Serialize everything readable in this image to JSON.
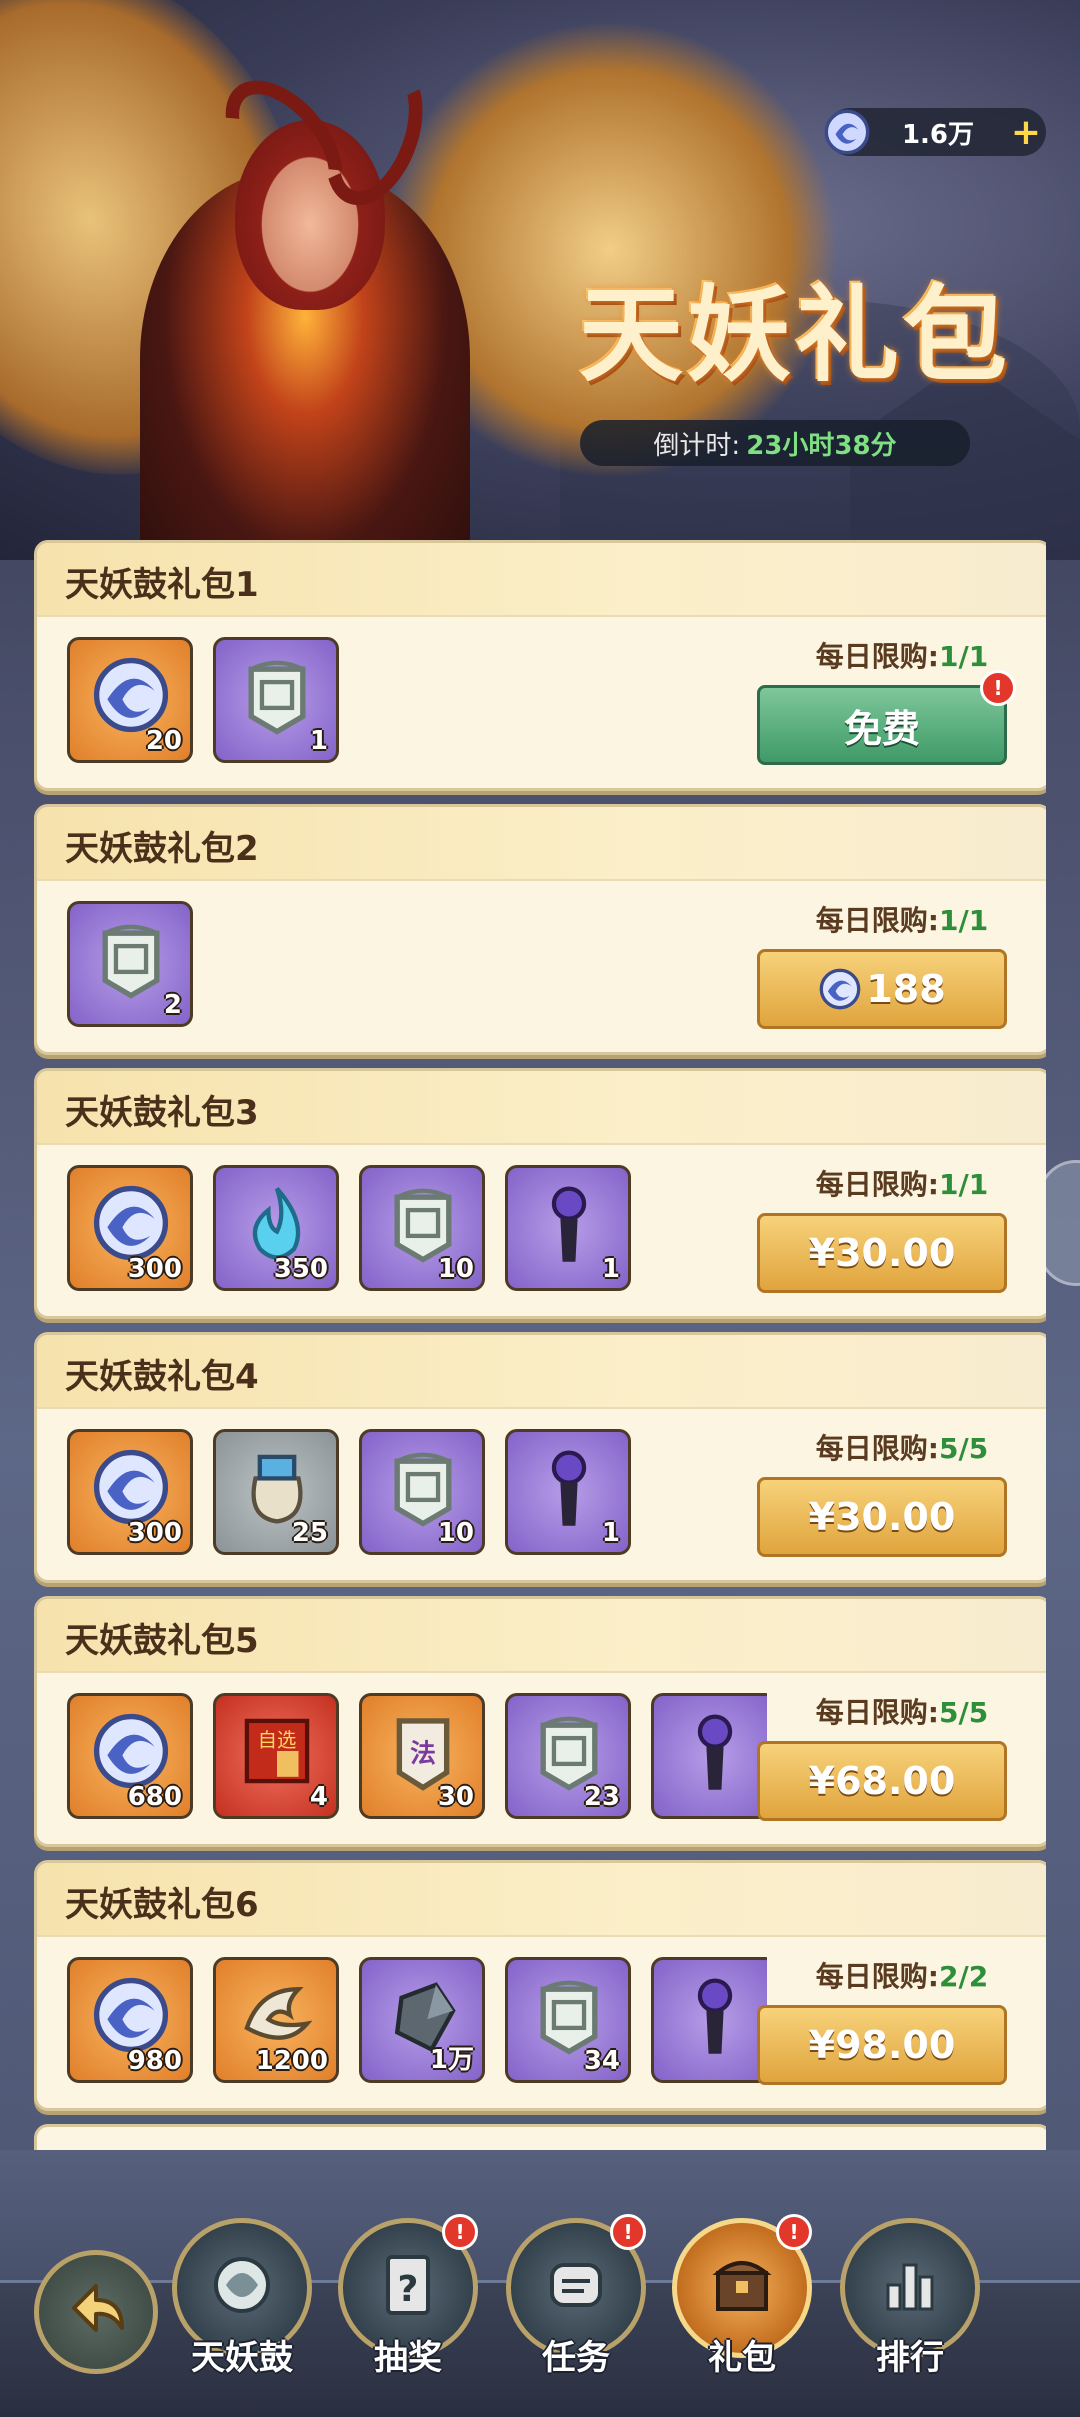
{
  "header": {
    "title": "天妖礼包",
    "countdown_label": "倒计时:",
    "countdown_value": "23小时38分",
    "currency_amount": "1.6万",
    "currency_plus": "+"
  },
  "packs": [
    {
      "name": "天妖鼓礼包1",
      "limit_label": "每日限购:",
      "limit_value": "1/1",
      "price": "免费",
      "items": [
        {
          "icon": "spirit-orb-icon",
          "count": "20"
        },
        {
          "icon": "tianyao-token-icon",
          "count": "1"
        }
      ]
    },
    {
      "name": "天妖鼓礼包2",
      "limit_label": "每日限购:",
      "limit_value": "1/1",
      "price": "188",
      "items": [
        {
          "icon": "tianyao-token-icon",
          "count": "2"
        }
      ]
    },
    {
      "name": "天妖鼓礼包3",
      "limit_label": "每日限购:",
      "limit_value": "1/1",
      "price": "¥30.00",
      "items": [
        {
          "icon": "spirit-orb-icon",
          "count": "300"
        },
        {
          "icon": "blue-flame-icon",
          "count": "350"
        },
        {
          "icon": "tianyao-token-icon",
          "count": "10"
        },
        {
          "icon": "purple-gem-icon",
          "count": "1"
        }
      ]
    },
    {
      "name": "天妖鼓礼包4",
      "limit_label": "每日限购:",
      "limit_value": "5/5",
      "price": "¥30.00",
      "items": [
        {
          "icon": "spirit-orb-icon",
          "count": "300"
        },
        {
          "icon": "treasure-bag-icon",
          "count": "25"
        },
        {
          "icon": "tianyao-token-icon",
          "count": "10"
        },
        {
          "icon": "purple-gem-icon",
          "count": "1"
        }
      ]
    },
    {
      "name": "天妖鼓礼包5",
      "limit_label": "每日限购:",
      "limit_value": "5/5",
      "price": "¥68.00",
      "items": [
        {
          "icon": "spirit-orb-icon",
          "count": "680"
        },
        {
          "icon": "selection-box-icon",
          "count": "4",
          "text": "自选"
        },
        {
          "icon": "law-token-icon",
          "count": "30",
          "text": "法"
        },
        {
          "icon": "tianyao-token-icon",
          "count": "23"
        },
        {
          "icon": "purple-gem-icon",
          "count": ""
        }
      ]
    },
    {
      "name": "天妖鼓礼包6",
      "limit_label": "每日限购:",
      "limit_value": "2/2",
      "price": "¥98.00",
      "items": [
        {
          "icon": "spirit-orb-icon",
          "count": "980"
        },
        {
          "icon": "bone-claw-icon",
          "count": "1200"
        },
        {
          "icon": "ore-stone-icon",
          "count": "1万"
        },
        {
          "icon": "tianyao-token-icon",
          "count": "34"
        },
        {
          "icon": "purple-gem-icon",
          "count": ""
        }
      ]
    }
  ],
  "nav": [
    {
      "label": "天妖鼓",
      "badge": ""
    },
    {
      "label": "抽奖",
      "badge": "!"
    },
    {
      "label": "任务",
      "badge": "!"
    },
    {
      "label": "礼包",
      "badge": "!"
    },
    {
      "label": "排行",
      "badge": ""
    }
  ],
  "pack1_badge": "!",
  "colors": {
    "accent_green": "#2e8f3a",
    "gold_button": "#e0a43d",
    "free_button": "#3f9a68"
  }
}
